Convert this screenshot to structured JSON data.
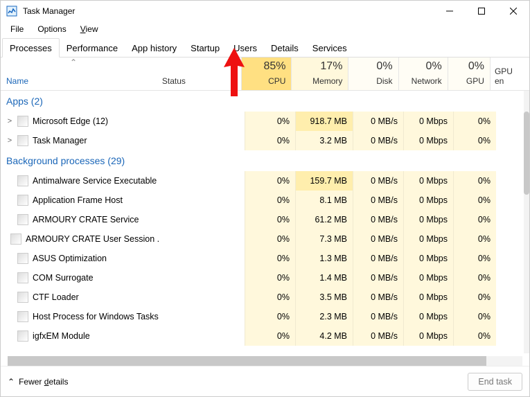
{
  "window": {
    "title": "Task Manager"
  },
  "menus": {
    "file": "File",
    "options": "Options",
    "view": "View"
  },
  "tabs": {
    "processes": "Processes",
    "performance": "Performance",
    "app_history": "App history",
    "startup": "Startup",
    "users": "Users",
    "details": "Details",
    "services": "Services",
    "active": "processes"
  },
  "columns": {
    "name": "Name",
    "status": "Status",
    "cpu": {
      "pct": "85%",
      "label": "CPU"
    },
    "memory": {
      "pct": "17%",
      "label": "Memory"
    },
    "disk": {
      "pct": "0%",
      "label": "Disk"
    },
    "network": {
      "pct": "0%",
      "label": "Network"
    },
    "gpu": {
      "pct": "0%",
      "label": "GPU"
    },
    "gpu_engine": "GPU en"
  },
  "groups": {
    "apps": "Apps (2)",
    "bg": "Background processes (29)"
  },
  "apps": [
    {
      "name": "Microsoft Edge (12)",
      "expandable": true,
      "cpu": "0%",
      "mem": "918.7 MB",
      "disk": "0 MB/s",
      "net": "0 Mbps",
      "gpu": "0%"
    },
    {
      "name": "Task Manager",
      "expandable": true,
      "cpu": "0%",
      "mem": "3.2 MB",
      "disk": "0 MB/s",
      "net": "0 Mbps",
      "gpu": "0%"
    }
  ],
  "bg": [
    {
      "name": "Antimalware Service Executable",
      "cpu": "0%",
      "mem": "159.7 MB",
      "disk": "0 MB/s",
      "net": "0 Mbps",
      "gpu": "0%"
    },
    {
      "name": "Application Frame Host",
      "cpu": "0%",
      "mem": "8.1 MB",
      "disk": "0 MB/s",
      "net": "0 Mbps",
      "gpu": "0%"
    },
    {
      "name": "ARMOURY CRATE Service",
      "cpu": "0%",
      "mem": "61.2 MB",
      "disk": "0 MB/s",
      "net": "0 Mbps",
      "gpu": "0%"
    },
    {
      "name": "ARMOURY CRATE User Session ...",
      "cpu": "0%",
      "mem": "7.3 MB",
      "disk": "0 MB/s",
      "net": "0 Mbps",
      "gpu": "0%"
    },
    {
      "name": "ASUS Optimization",
      "cpu": "0%",
      "mem": "1.3 MB",
      "disk": "0 MB/s",
      "net": "0 Mbps",
      "gpu": "0%"
    },
    {
      "name": "COM Surrogate",
      "cpu": "0%",
      "mem": "1.4 MB",
      "disk": "0 MB/s",
      "net": "0 Mbps",
      "gpu": "0%"
    },
    {
      "name": "CTF Loader",
      "cpu": "0%",
      "mem": "3.5 MB",
      "disk": "0 MB/s",
      "net": "0 Mbps",
      "gpu": "0%"
    },
    {
      "name": "Host Process for Windows Tasks",
      "cpu": "0%",
      "mem": "2.3 MB",
      "disk": "0 MB/s",
      "net": "0 Mbps",
      "gpu": "0%"
    },
    {
      "name": "igfxEM Module",
      "cpu": "0%",
      "mem": "4.2 MB",
      "disk": "0 MB/s",
      "net": "0 Mbps",
      "gpu": "0%"
    }
  ],
  "footer": {
    "fewer_details_pre": "Fewer ",
    "fewer_details_u": "d",
    "fewer_details_post": "etails",
    "end_task": "End task"
  },
  "heat": {
    "cpu_header": "heat-3",
    "mem_header": "heat-2",
    "default_header": "heat-0"
  }
}
